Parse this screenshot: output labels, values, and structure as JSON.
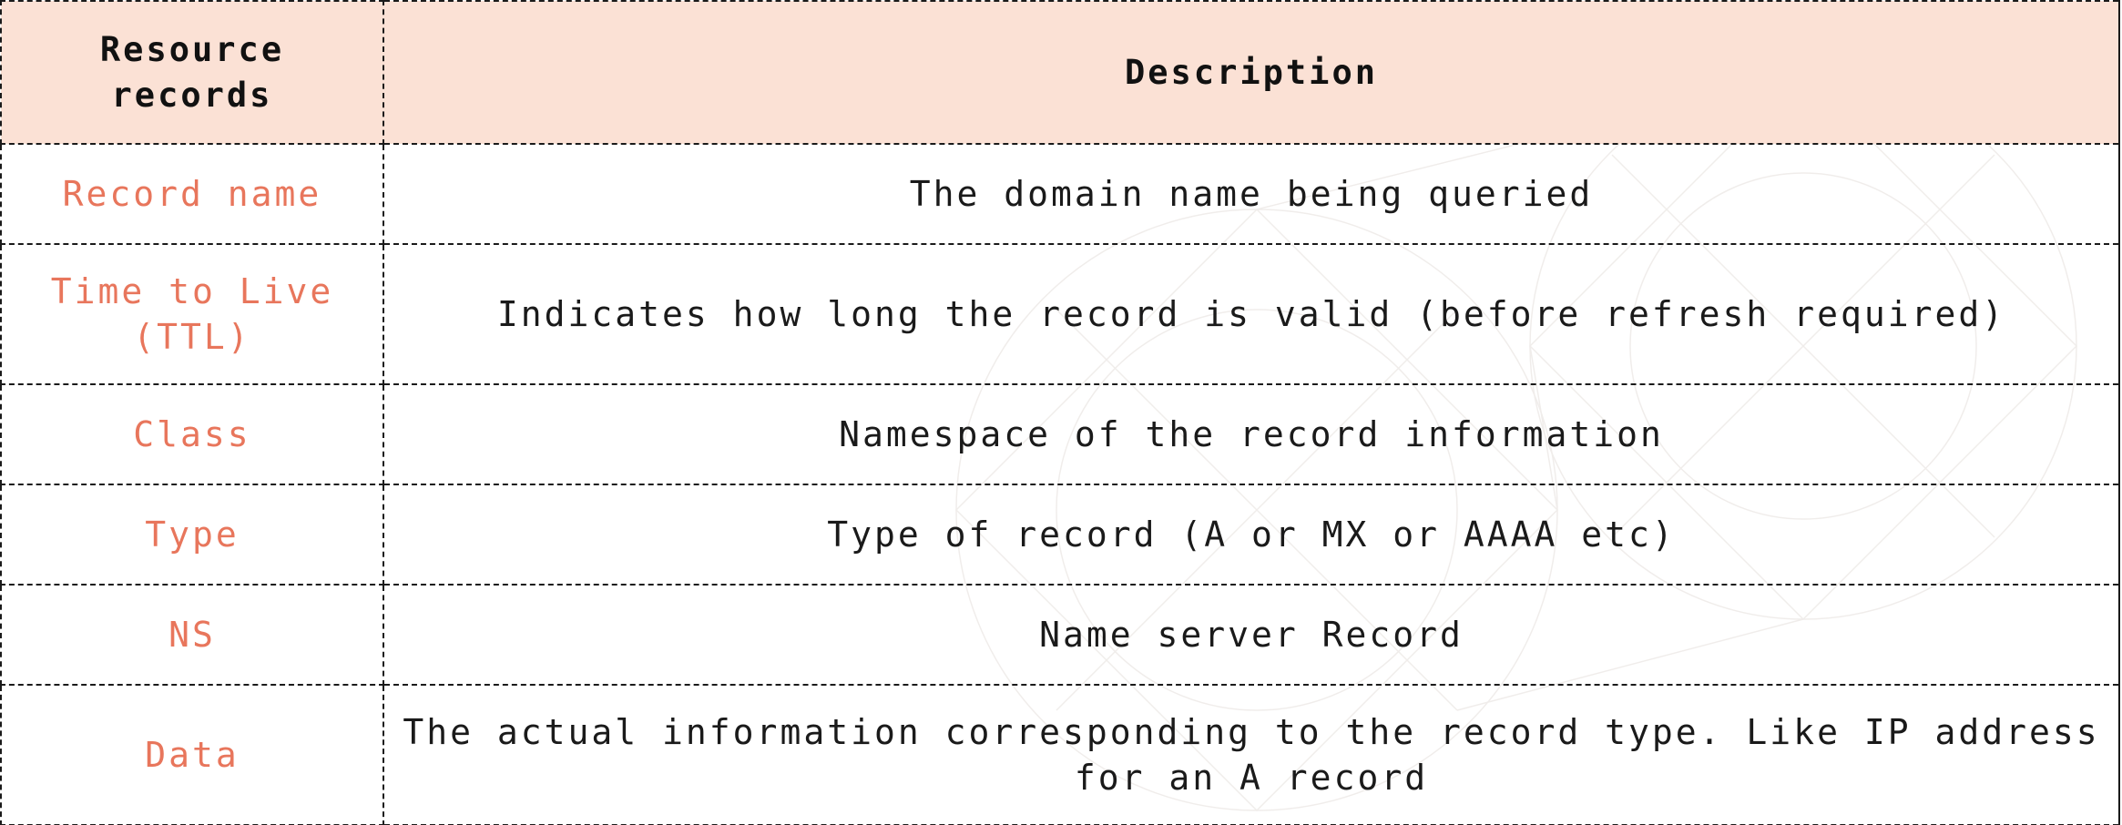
{
  "table": {
    "header": {
      "col1": "Resource records",
      "col2": "Description"
    },
    "rows": [
      {
        "record": "Record name",
        "description": "The domain name being queried"
      },
      {
        "record": "Time to Live (TTL)",
        "description": "Indicates how long the record is valid (before refresh required)"
      },
      {
        "record": "Class",
        "description": "Namespace of the record information"
      },
      {
        "record": "Type",
        "description": "Type of record (A or MX or AAAA etc)"
      },
      {
        "record": "NS",
        "description": "Name server Record"
      },
      {
        "record": "Data",
        "description": "The actual information corresponding to the record type. Like IP address for an A record"
      }
    ]
  },
  "colors": {
    "header_bg": "#fbe1d5",
    "record_text": "#e8765c",
    "body_text": "#1a1a1a"
  }
}
